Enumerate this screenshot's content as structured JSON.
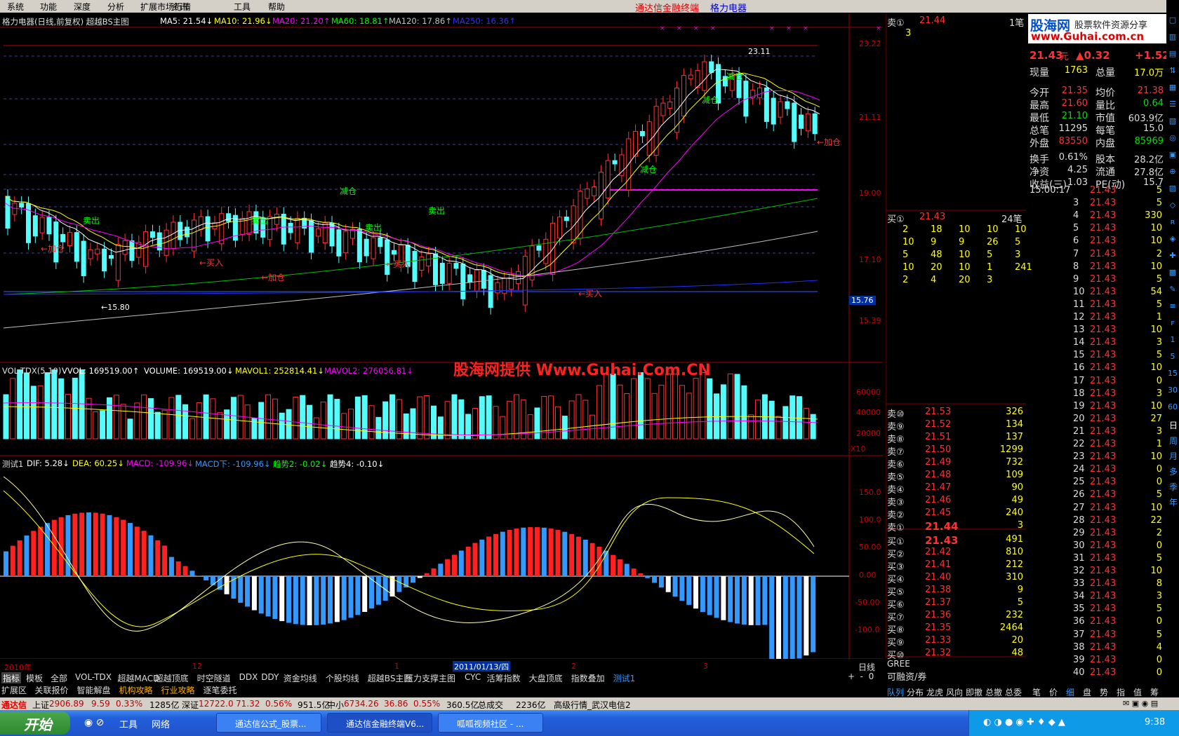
{
  "menu": {
    "items": [
      "系统",
      "功能",
      "深度",
      "分析",
      "扩展市场行情",
      "资讯",
      "工具",
      "帮助"
    ],
    "center_title": "通达信金融终端",
    "stock_name": "格力电器"
  },
  "chart_header": {
    "title": "格力电器(日线,前复权) 超越BS主图",
    "ma5": "MA5: 21.54↓",
    "ma10": "MA10: 21.96↓",
    "ma20": "MA20: 21.20↑",
    "ma60": "MA60: 18.81↑",
    "ma120": "MA120: 17.86↑",
    "ma250": "MA250: 16.36↑"
  },
  "price_axis": [
    "23.22",
    "21.11",
    "19.00",
    "17.10",
    "15.39"
  ],
  "current_price_tag": "15.76",
  "annotations": {
    "high": "23.11",
    "low": "←15.80",
    "sell1": "卖出",
    "sell2": "卖出",
    "sell3": "卖出",
    "sell4": "卖出",
    "reduce1": "减仓",
    "reduce2": "减仓",
    "reduce3": "减仓",
    "reduce4": "减仓",
    "add1": "←加仓",
    "add2": "←加仓",
    "add3": "←加仓",
    "buy1": "←买入",
    "buy2": "←买入",
    "buy3": "←买入"
  },
  "volume_header": {
    "title": "VOL-TDX(5,10)",
    "vvol": "VVOL: 169519.00↑",
    "volume": "VOLUME: 169519.00↓",
    "mavol1": "MAVOL1: 252814.41↓",
    "mavol2": "MAVOL2: 276056.81↓"
  },
  "volume_axis": [
    "60000",
    "40000",
    "20000",
    "X10"
  ],
  "macd_header": {
    "title": "测试1",
    "dif": "DIF: 5.28↓",
    "dea": "DEA: 60.25↓",
    "macd": "MACD: -109.96↓",
    "macd_down": "MACD下: -109.96↓",
    "trend2": "趋势2: -0.02↓",
    "trend4": "趋势4: -0.10↓"
  },
  "macd_axis": [
    "150.0",
    "100.0",
    "50.00",
    "0.00",
    "-50.00",
    "-100.0"
  ],
  "date_axis": {
    "start": "2010年",
    "m12": "12",
    "m1": "1",
    "cursor_date": "2011/01/13/四",
    "m2": "2",
    "m3": "3",
    "period": "日线"
  },
  "watermark": "股海网提供 Www.Guhai.Com.CN",
  "quote": {
    "sell1_label": "卖①",
    "sell1_price": "21.44",
    "sell1_count": "1笔",
    "sell1_vol": "3",
    "logo_text": "股海网",
    "logo_sub": "股票软件资源分享",
    "logo_url": "www.Guhai.com.cn",
    "last": "21.43",
    "unit": "元",
    "change": "▲0.32",
    "change_pct": "+1.52",
    "stats": [
      {
        "k1": "现量",
        "v1": "1763",
        "k2": "总量",
        "v2": "17.0万"
      },
      {
        "k1": "今开",
        "v1": "21.35",
        "k2": "均价",
        "v2": "21.38"
      },
      {
        "k1": "最高",
        "v1": "21.60",
        "k2": "量比",
        "v2": "0.64"
      },
      {
        "k1": "最低",
        "v1": "21.10",
        "k2": "市值",
        "v2": "603.9亿"
      },
      {
        "k1": "总笔",
        "v1": "11295",
        "k2": "每笔",
        "v2": "15.0"
      },
      {
        "k1": "外盘",
        "v1": "83550",
        "k2": "内盘",
        "v2": "85969"
      },
      {
        "k1": "换手",
        "v1": "0.61%",
        "k2": "股本",
        "v2": "28.2亿"
      },
      {
        "k1": "净资",
        "v1": "4.25",
        "k2": "流通",
        "v2": "27.8亿"
      },
      {
        "k1": "收益(三)",
        "v1": "1.03",
        "k2": "PE(动)",
        "v2": "15.7"
      }
    ],
    "buy1_label": "买①",
    "buy1_price": "21.43",
    "buy1_count": "24笔",
    "queue": [
      [
        "2",
        "18",
        "10",
        "10",
        "10"
      ],
      [
        "10",
        "9",
        "9",
        "26",
        "5"
      ],
      [
        "5",
        "48",
        "10",
        "5",
        "3"
      ],
      [
        "10",
        "20",
        "10",
        "1",
        "241"
      ],
      [
        "2",
        "4",
        "20",
        "3",
        ""
      ]
    ],
    "depth_sell": [
      {
        "label": "卖⑩",
        "price": "21.53",
        "vol": "326"
      },
      {
        "label": "卖⑨",
        "price": "21.52",
        "vol": "134"
      },
      {
        "label": "卖⑧",
        "price": "21.51",
        "vol": "137"
      },
      {
        "label": "卖⑦",
        "price": "21.50",
        "vol": "1299"
      },
      {
        "label": "卖⑥",
        "price": "21.49",
        "vol": "732"
      },
      {
        "label": "卖⑤",
        "price": "21.48",
        "vol": "109"
      },
      {
        "label": "卖④",
        "price": "21.47",
        "vol": "90"
      },
      {
        "label": "卖③",
        "price": "21.46",
        "vol": "49"
      },
      {
        "label": "卖②",
        "price": "21.45",
        "vol": "240"
      },
      {
        "label": "卖①",
        "price": "21.44",
        "vol": "3"
      }
    ],
    "depth_buy": [
      {
        "label": "买①",
        "price": "21.43",
        "vol": "491"
      },
      {
        "label": "买②",
        "price": "21.42",
        "vol": "810"
      },
      {
        "label": "买③",
        "price": "21.41",
        "vol": "212"
      },
      {
        "label": "买④",
        "price": "21.40",
        "vol": "310"
      },
      {
        "label": "买⑤",
        "price": "21.38",
        "vol": "9"
      },
      {
        "label": "买⑥",
        "price": "21.37",
        "vol": "5"
      },
      {
        "label": "买⑦",
        "price": "21.36",
        "vol": "232"
      },
      {
        "label": "买⑧",
        "price": "21.35",
        "vol": "2464"
      },
      {
        "label": "买⑨",
        "price": "21.33",
        "vol": "20"
      },
      {
        "label": "买⑩",
        "price": "21.32",
        "vol": "48"
      }
    ],
    "code_name": "GREE",
    "margin": "可融资/券",
    "bottom_tabs": [
      "队列",
      "分布",
      "龙虎",
      "风向",
      "即撤",
      "总撤",
      "总委"
    ]
  },
  "ticks": {
    "first_time": "15:00:17",
    "rows": [
      [
        "15:00:17",
        "21.43",
        "5"
      ],
      [
        "3",
        "21.43",
        "5"
      ],
      [
        "4",
        "21.43",
        "330"
      ],
      [
        "5",
        "21.43",
        "10"
      ],
      [
        "6",
        "21.43",
        "10"
      ],
      [
        "7",
        "21.43",
        "2"
      ],
      [
        "8",
        "21.43",
        "10"
      ],
      [
        "9",
        "21.43",
        "5"
      ],
      [
        "10",
        "21.43",
        "54"
      ],
      [
        "11",
        "21.43",
        "5"
      ],
      [
        "12",
        "21.43",
        "1"
      ],
      [
        "13",
        "21.43",
        "10"
      ],
      [
        "14",
        "21.43",
        "3"
      ],
      [
        "15",
        "21.43",
        "5"
      ],
      [
        "16",
        "21.43",
        "10"
      ],
      [
        "17",
        "21.43",
        "0"
      ],
      [
        "18",
        "21.43",
        "3"
      ],
      [
        "19",
        "21.43",
        "10"
      ],
      [
        "20",
        "21.43",
        "27"
      ],
      [
        "21",
        "21.43",
        "3"
      ],
      [
        "22",
        "21.43",
        "1"
      ],
      [
        "23",
        "21.43",
        "10"
      ],
      [
        "24",
        "21.43",
        "0"
      ],
      [
        "25",
        "21.43",
        "0"
      ],
      [
        "26",
        "21.43",
        "5"
      ],
      [
        "27",
        "21.43",
        "10"
      ],
      [
        "28",
        "21.43",
        "22"
      ],
      [
        "29",
        "21.43",
        "2"
      ],
      [
        "30",
        "21.43",
        "0"
      ],
      [
        "31",
        "21.43",
        "5"
      ],
      [
        "32",
        "21.43",
        "10"
      ],
      [
        "33",
        "21.43",
        "8"
      ],
      [
        "34",
        "21.43",
        "3"
      ],
      [
        "35",
        "21.43",
        "5"
      ],
      [
        "36",
        "21.43",
        "0"
      ],
      [
        "37",
        "21.43",
        "5"
      ],
      [
        "38",
        "21.43",
        "4"
      ],
      [
        "39",
        "21.43",
        "0"
      ],
      [
        "40",
        "21.43",
        "0"
      ]
    ],
    "bottom_tabs": [
      "笔",
      "价",
      "细",
      "盘",
      "势",
      "指",
      "值",
      "筹"
    ]
  },
  "tabs_row1": [
    "指标",
    "模板",
    "全部",
    "VOL-TDX",
    "超越MACD",
    "超越顶底",
    "时空隧道",
    "DDX",
    "DDY",
    "资金均线",
    "个股均线",
    "超越BS主图",
    "压力支撑主图",
    "CYC",
    "活筹指数",
    "大盘顶底",
    "指数叠加",
    "测试1"
  ],
  "tabs_row2": [
    "扩展区",
    "关联报价",
    "智能解盘",
    "机构攻略",
    "行业攻略",
    "逐笔委托"
  ],
  "status": {
    "app": "通达信",
    "sh_label": "上证",
    "sh": "2906.89",
    "sh_chg": "9.59",
    "sh_pct": "0.33%",
    "sh_amt": "1285亿",
    "sz_label": "深证",
    "sz": "12722.0",
    "sz_chg": "71.32",
    "sz_pct": "0.56%",
    "sz_amt": "951.5亿",
    "zx_label": "中小",
    "zx": "6734.26",
    "zx_chg": "36.86",
    "zx_pct": "0.55%",
    "zx_amt": "360.5亿",
    "total_label": "总成交",
    "total": "2236亿",
    "server": "高级行情_武汉电信2"
  },
  "taskbar": {
    "start": "开始",
    "tool": "工具",
    "net": "网络",
    "tasks": [
      "通达信公式_股票...",
      "通达信金融终端V6...",
      "呱呱视频社区 - ..."
    ],
    "clock": "9:38"
  },
  "sidebar_labels": [
    "日",
    "周",
    "月",
    "多",
    "季",
    "年"
  ],
  "colors": {
    "up": "#ff3232",
    "down": "#54fcfc",
    "ma5": "#ffffff",
    "ma10": "#ffff00",
    "ma20": "#ff00ff",
    "ma60": "#00ff00",
    "ma120": "#c0c0c0",
    "ma250": "#0000ff"
  }
}
